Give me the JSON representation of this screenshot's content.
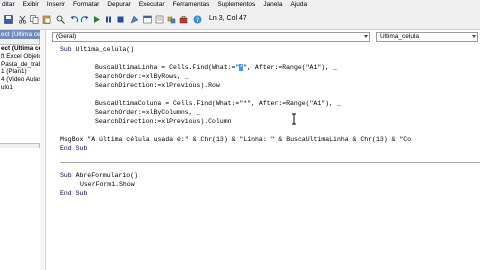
{
  "menubar": {
    "items": [
      "ditar",
      "Exibir",
      "Inserir",
      "Formatar",
      "Depurar",
      "Executar",
      "Ferramentas",
      "Suplementos",
      "Janela",
      "Ajuda"
    ]
  },
  "toolbar": {
    "position": "Ln 3, Col 47",
    "icons": [
      "save-icon",
      "cut-icon",
      "copy-icon",
      "paste-icon",
      "find-icon",
      "undo-icon",
      "redo-icon",
      "run-icon",
      "pause-icon",
      "stop-icon",
      "design-mode-icon",
      "project-explorer-icon",
      "properties-icon",
      "object-browser-icon",
      "toolbox-icon",
      "help-icon"
    ]
  },
  "project_panel": {
    "header": "ect (Ultima celu",
    "items": [
      {
        "label": "ect (Ultima celu",
        "selected": true
      },
      {
        "label": "ft Excel Objetos",
        "selected": false
      },
      {
        "label": "Pasta_de_trab",
        "selected": false
      },
      {
        "label": "1 (Plan1)",
        "selected": false
      },
      {
        "label": "4 (Video Aulas)",
        "selected": false
      },
      {
        "label": "",
        "selected": false
      },
      {
        "label": "ulo1",
        "selected": false
      }
    ]
  },
  "editor": {
    "object_dropdown": "(Geral)",
    "procedure_dropdown": "Ultima_celula",
    "code_lines": [
      {
        "kw": "Sub",
        "rest": " Ultima_celula()",
        "indent": 0
      },
      {
        "kw": "",
        "rest": "",
        "indent": 0
      },
      {
        "kw": "",
        "rest": "BuscaUltimaLinha = Cells.Find(What:=\"",
        "hl": "*",
        "rest2": "\", After:=Range(\"A1\"), _",
        "indent": 4
      },
      {
        "kw": "",
        "rest": "SearchOrder:=xlByRows, _",
        "indent": 4
      },
      {
        "kw": "",
        "rest": "SearchDirection:=xlPrevious).Row",
        "indent": 4
      },
      {
        "kw": "",
        "rest": "",
        "indent": 0
      },
      {
        "kw": "",
        "rest": "BuscaUltimaColuna = Cells.Find(What:=\"*\", After:=Range(\"A1\"), _",
        "indent": 4
      },
      {
        "kw": "",
        "rest": "SearchOrder:=xlByColumns, _",
        "indent": 4
      },
      {
        "kw": "",
        "rest": "SearchDirection:=xlPrevious).Column",
        "indent": 4
      },
      {
        "kw": "",
        "rest": "",
        "indent": 0
      },
      {
        "kw": "",
        "rest": "MsgBox \"A última célula usada é:\" & Chr(13) & \"Linha: \" & BuscaUltimaLinha & Chr(13) & \"Co",
        "indent": 0
      },
      {
        "kw": "End Sub",
        "rest": "",
        "indent": 0
      },
      {
        "kw": "",
        "rest": "",
        "indent": 0
      },
      {
        "kw": "Sub",
        "rest": " AbreFormulario()",
        "indent": 0
      },
      {
        "kw": "",
        "rest": "UserForm1.Show",
        "indent": 3
      },
      {
        "kw": "End Sub",
        "rest": "",
        "indent": 0
      }
    ]
  }
}
